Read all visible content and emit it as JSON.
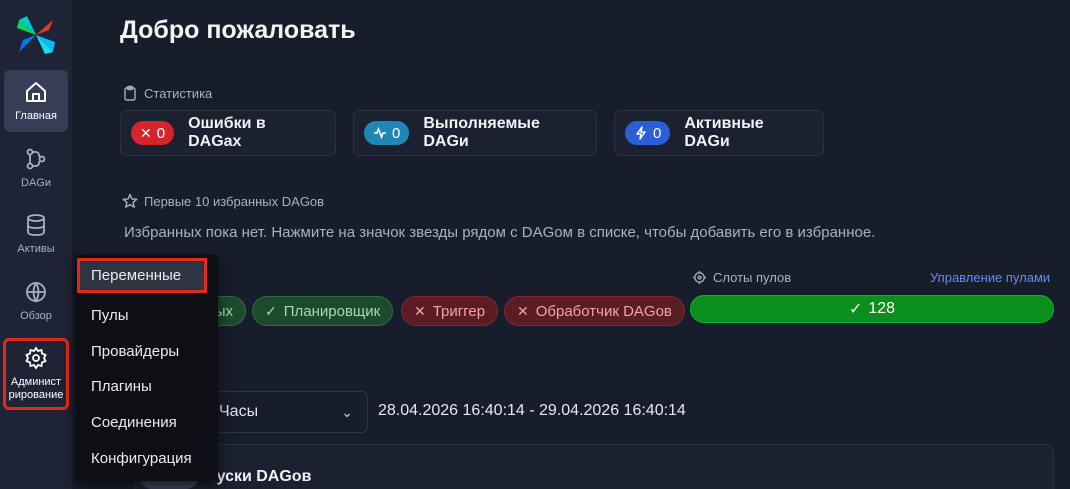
{
  "sidebar": {
    "items": [
      {
        "label": "Главная",
        "icon": "home-icon",
        "active": true
      },
      {
        "label": "DAGи",
        "icon": "dag-icon"
      },
      {
        "label": "Активы",
        "icon": "database-icon"
      },
      {
        "label": "Обзор",
        "icon": "globe-icon"
      },
      {
        "label": "Администрирование",
        "label_line1": "Админист",
        "label_line2": "рирование",
        "icon": "gear-icon",
        "highlighted": true
      }
    ]
  },
  "header": {
    "title": "Добро пожаловать"
  },
  "stats": {
    "heading": "Статистика",
    "cards": [
      {
        "count": "0",
        "label": "Ошибки в DAGах",
        "color": "#d6242c",
        "icon": "✕"
      },
      {
        "count": "0",
        "label": "Выполняемые DAGи",
        "color": "#1f86b5",
        "icon": "pulse-icon"
      },
      {
        "count": "0",
        "label": "Активные DAGи",
        "color": "#2a5fd8",
        "icon": "lightning-icon"
      }
    ]
  },
  "favorites": {
    "heading": "Первые 10 избранных DAGов",
    "empty_message": "Избранных пока нет. Нажмите на значок звезды рядом с DAGом в списке, чтобы добавить его в избранное."
  },
  "health": {
    "partial_label": "ых",
    "items": [
      {
        "label": "Планировщик",
        "status": "ok"
      },
      {
        "label": "Триггер",
        "status": "error"
      },
      {
        "label": "Обработчик DAGов",
        "status": "error"
      }
    ]
  },
  "pools": {
    "heading": "Слоты пулов",
    "manage_link": "Управление пулами",
    "slots": "128"
  },
  "time_filter": {
    "selected": "Часы",
    "range": "28.04.2026 16:40:14 - 29.04.2026 16:40:14"
  },
  "runs": {
    "title_visible": "апуски DAGов"
  },
  "admin_menu": {
    "items": [
      "Переменные",
      "Пулы",
      "Провайдеры",
      "Плагины",
      "Соединения",
      "Конфигурация"
    ],
    "highlighted": "Переменные"
  }
}
